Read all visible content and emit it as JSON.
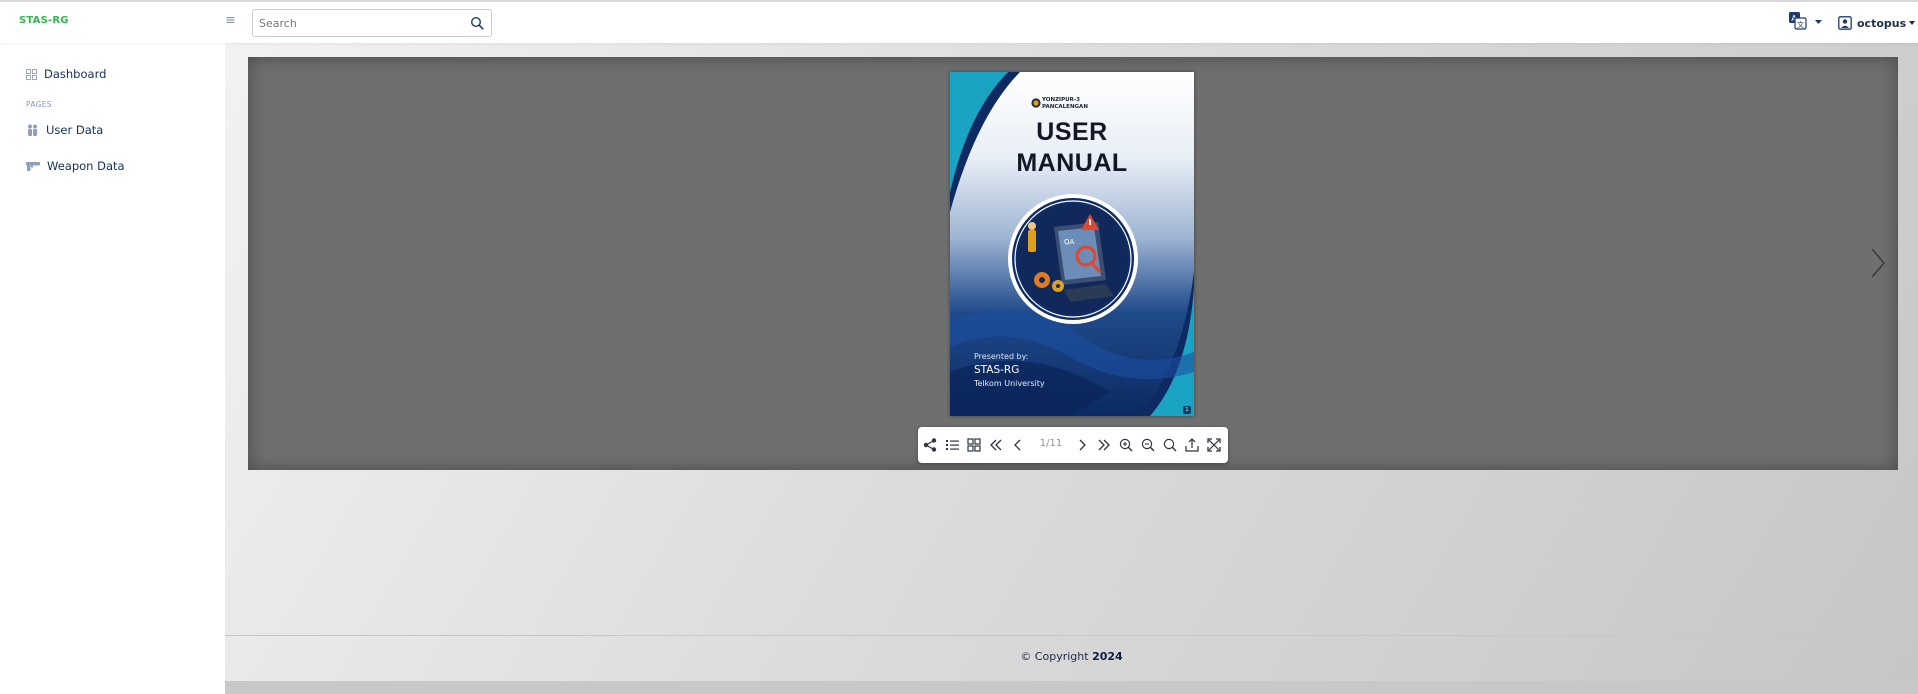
{
  "brand": {
    "name": "STAS-RG"
  },
  "header": {
    "search": {
      "placeholder": "Search",
      "value": ""
    },
    "user": {
      "name": "octopus"
    }
  },
  "sidebar": {
    "items": [
      {
        "label": "Dashboard",
        "icon": "grid-icon"
      },
      {
        "label": "User Data",
        "icon": "users-icon"
      },
      {
        "label": "Weapon Data",
        "icon": "gun-icon"
      }
    ],
    "section_heading": "PAGES"
  },
  "viewer": {
    "cover": {
      "org_line1": "YONZIPUR-3",
      "org_line2": "PANCALENGAN",
      "title_line1": "USER",
      "title_line2": "MANUAL",
      "presented_by": "Presented by:",
      "presenter": "STAS-RG",
      "institution": "Telkom University",
      "page_badge": "1"
    },
    "toolbar": {
      "page_indicator": "1/11",
      "buttons": [
        "share-icon",
        "toc-icon",
        "thumbnails-icon",
        "first-page-icon",
        "prev-page-icon",
        "next-page-icon",
        "last-page-icon",
        "zoom-in-icon",
        "zoom-out-icon",
        "search-icon",
        "download-icon",
        "fullscreen-icon"
      ]
    }
  },
  "footer": {
    "copyright_prefix": "© Copyright",
    "year": "2024"
  },
  "colors": {
    "brand": "#2db94d",
    "nav_text": "#163057",
    "viewer_bg": "#6f6f6f"
  }
}
